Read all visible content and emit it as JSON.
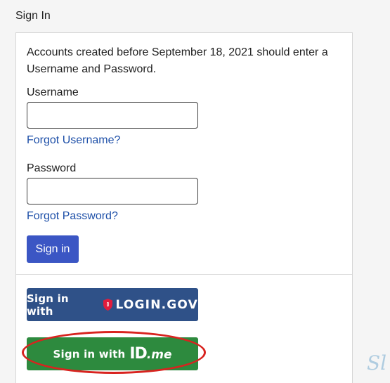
{
  "section_title": "Sign In",
  "intro_text": "Accounts created before September 18, 2021 should enter a Username and Password.",
  "username": {
    "label": "Username",
    "value": "",
    "forgot_link": "Forgot Username?"
  },
  "password": {
    "label": "Password",
    "value": "",
    "forgot_link": "Forgot Password?"
  },
  "signin_button_label": "Sign in",
  "providers": {
    "logingov": {
      "prefix": "Sign in with",
      "brand": "LOGIN.GOV",
      "color": "#2f5188"
    },
    "idme": {
      "prefix": "Sign in with",
      "brand_id": "ID",
      "brand_me": ".me",
      "color": "#2d8a3e"
    }
  },
  "annotation": {
    "highlight_color": "#d8231f"
  },
  "watermark": "Sl",
  "colors": {
    "primary_button": "#3b56c4",
    "link": "#1d4fa8"
  }
}
